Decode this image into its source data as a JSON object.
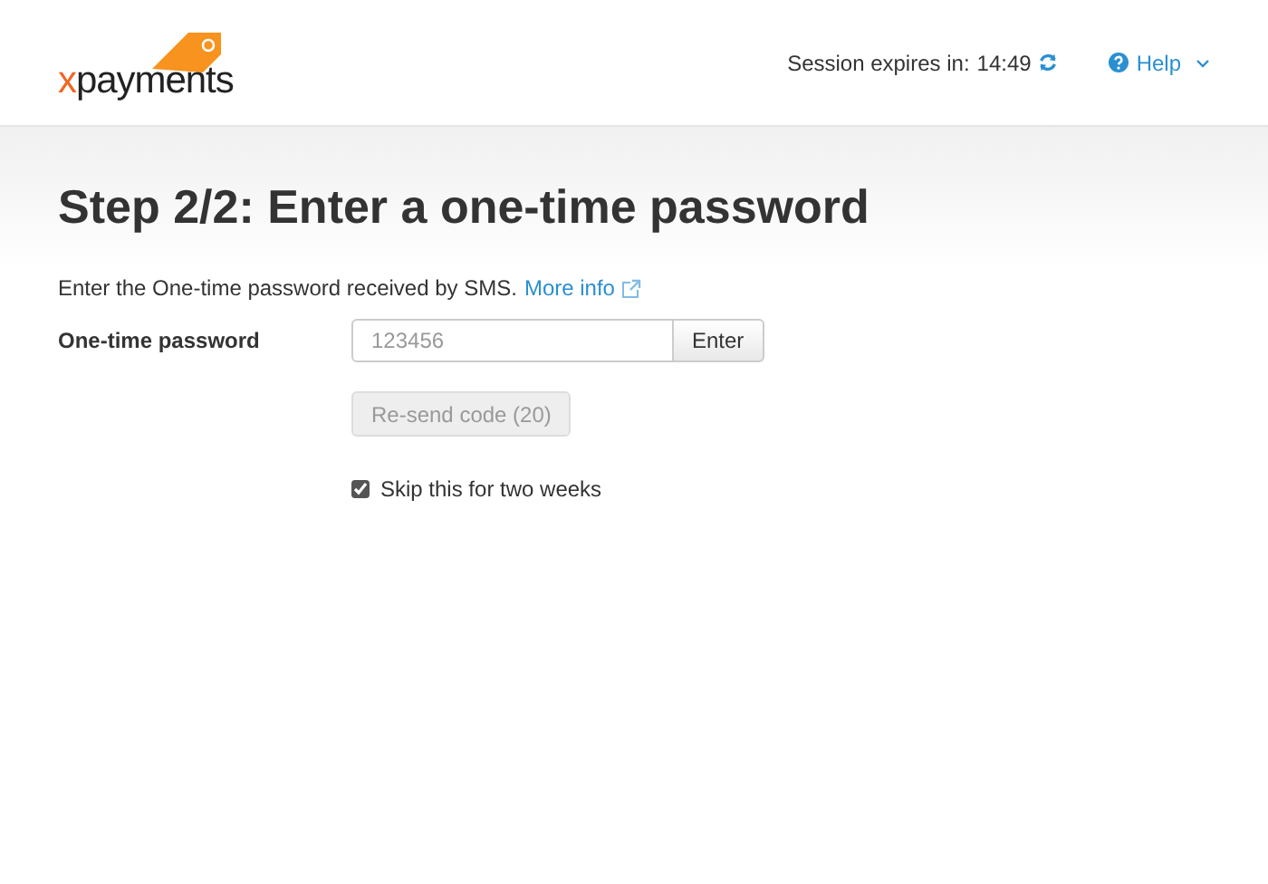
{
  "logo": {
    "accent": "x",
    "rest": "payments"
  },
  "session": {
    "label": "Session expires in:",
    "time": "14:49"
  },
  "help": {
    "label": "Help"
  },
  "title": "Step 2/2: Enter a one-time password",
  "intro": {
    "text": "Enter the One-time password received by SMS.",
    "link": "More info"
  },
  "otp": {
    "label": "One-time password",
    "placeholder": "123456",
    "button": "Enter"
  },
  "resend": {
    "label": "Re-send code (20)",
    "disabled": true
  },
  "skip": {
    "label": "Skip this for two weeks",
    "checked": true
  }
}
